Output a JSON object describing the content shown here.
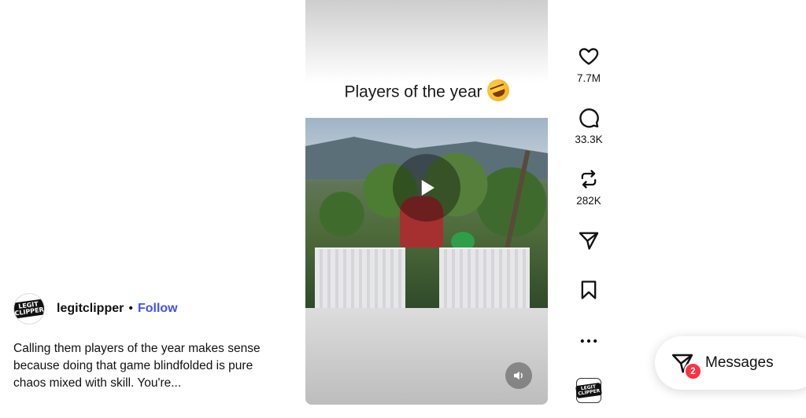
{
  "post": {
    "username": "legitclipper",
    "separator": "•",
    "follow_label": "Follow",
    "caption": "Calling them players of the year makes sense because doing that game blindfolded is pure chaos mixed with skill. You're...",
    "avatar_text": "LEGIT CLIPPER"
  },
  "video": {
    "overlay_title": "Players of the year",
    "overlay_emoji": "rolling-on-floor-laughing-emoji",
    "play_icon": "play-icon",
    "mute_icon": "volume-icon"
  },
  "actions": {
    "like_count": "7.7M",
    "comment_count": "33.3K",
    "repost_count": "282K",
    "more_label": "•••",
    "icons": [
      "heart-icon",
      "comment-icon",
      "repost-icon",
      "share-icon",
      "bookmark-icon",
      "more-icon"
    ]
  },
  "messages": {
    "label": "Messages",
    "badge": "2"
  },
  "colors": {
    "follow": "#4150f7",
    "badge": "#ff3040"
  }
}
